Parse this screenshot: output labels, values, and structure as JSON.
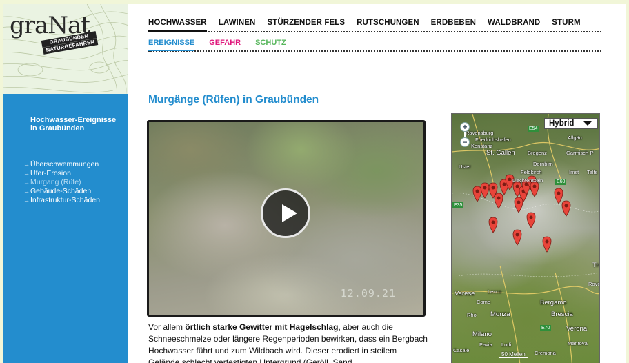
{
  "logo": {
    "word": "graNat",
    "tag_line1": "GRAUBÜNDEN",
    "tag_line2": "NATURGEFAHREN"
  },
  "nav_primary": [
    "HOCHWASSER",
    "LAWINEN",
    "STÜRZENDER FELS",
    "RUTSCHUNGEN",
    "ERDBEBEN",
    "WALDBRAND",
    "STURM"
  ],
  "nav_secondary": [
    {
      "label": "EREIGNISSE",
      "color": "#238dce"
    },
    {
      "label": "GEFAHR",
      "color": "#e0197d"
    },
    {
      "label": "SCHUTZ",
      "color": "#57b65c"
    }
  ],
  "sidebar": {
    "title": "Hochwasser-Ereignisse in Graubünden",
    "items": [
      "Überschwemmungen",
      "Ufer-Erosion",
      "Murgang (Rüfe)",
      "Gebäude-Schäden",
      "Infrastruktur-Schäden"
    ],
    "current_index": 2
  },
  "page_title": "Murgänge (Rüfen) in Graubünden",
  "video": {
    "timestamp": "12.09.21"
  },
  "body": {
    "intro": "Vor allem ",
    "bold": "örtlich starke Gewitter mit Hagelschlag",
    "rest": ", aber auch die Schneeschmelze oder längere Regenperioden bewirken, dass ein Bergbach Hochwasser führt und zum Wildbach wird. Dieser erodiert in steilem Gelände schlecht verfestigten Untergrund (Geröll, Sand,"
  },
  "map": {
    "type_select": "Hybrid",
    "zoom_in": "+",
    "zoom_out": "−",
    "scale": "50 Meilen",
    "places": [
      "Ravensburg",
      "Friedrichshafen",
      "Konstanz",
      "St. Gallen",
      "Bregenz",
      "Dornbirn",
      "Feldkirch",
      "Uster",
      "Liechtenstein",
      "Imst",
      "Telfs",
      "Garmisch-P",
      "Allgäu",
      "Varese",
      "Lecco",
      "Como",
      "Bergamo",
      "Rho",
      "Monza",
      "Brescia",
      "Milano",
      "Verona",
      "Rove",
      "Pavia",
      "Lodi",
      "Mantova",
      "Casale",
      "Cremona",
      "Tre"
    ],
    "roads": [
      "E54",
      "E60",
      "E70",
      "E35"
    ]
  }
}
